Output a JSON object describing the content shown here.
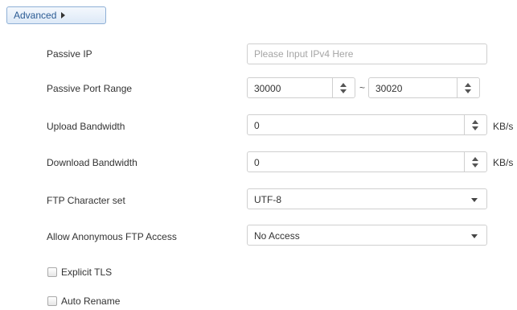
{
  "advanced_button": {
    "label": "Advanced"
  },
  "passive_ip": {
    "label": "Passive IP",
    "value": "",
    "placeholder": "Please Input IPv4 Here"
  },
  "passive_port_range": {
    "label": "Passive Port Range",
    "from": "30000",
    "separator": "~",
    "to": "30020"
  },
  "upload_bandwidth": {
    "label": "Upload Bandwidth",
    "value": "0",
    "unit": "KB/s"
  },
  "download_bandwidth": {
    "label": "Download Bandwidth",
    "value": "0",
    "unit": "KB/s"
  },
  "ftp_charset": {
    "label": "FTP Character set",
    "selected": "UTF-8"
  },
  "anonymous_access": {
    "label": "Allow Anonymous FTP Access",
    "selected": "No Access"
  },
  "explicit_tls": {
    "label": "Explicit TLS",
    "checked": false
  },
  "auto_rename": {
    "label": "Auto Rename",
    "checked": false
  }
}
